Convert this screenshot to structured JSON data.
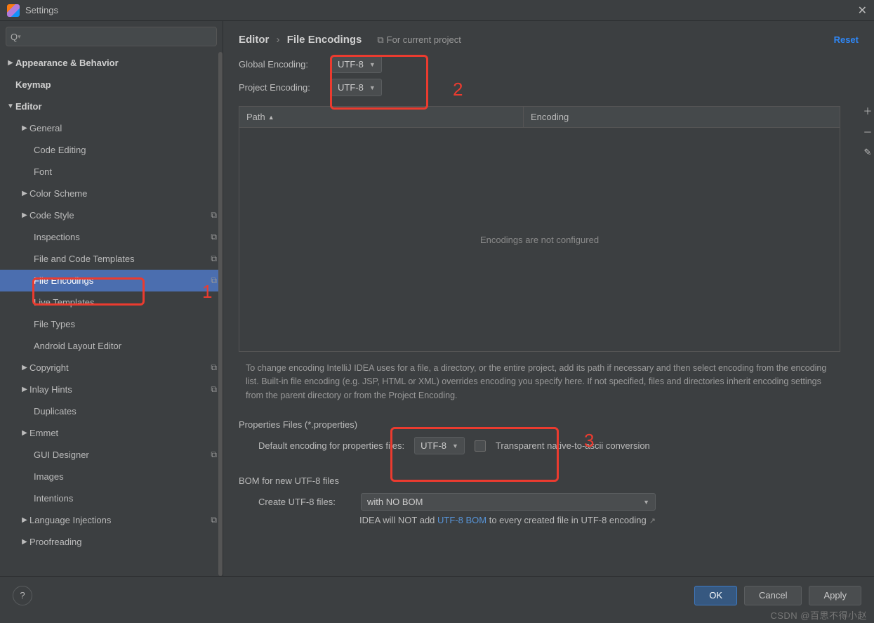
{
  "window": {
    "title": "Settings"
  },
  "search": {
    "placeholder": ""
  },
  "sidebar": {
    "items": [
      {
        "label": "Appearance & Behavior",
        "arrow": "▶",
        "bold": true,
        "indent": 0,
        "scheme": false
      },
      {
        "label": "Keymap",
        "arrow": "",
        "bold": true,
        "indent": 0,
        "scheme": false
      },
      {
        "label": "Editor",
        "arrow": "▼",
        "bold": true,
        "indent": 0,
        "scheme": false
      },
      {
        "label": "General",
        "arrow": "▶",
        "bold": false,
        "indent": 1,
        "scheme": false
      },
      {
        "label": "Code Editing",
        "arrow": "",
        "bold": false,
        "indent": 2,
        "scheme": false
      },
      {
        "label": "Font",
        "arrow": "",
        "bold": false,
        "indent": 2,
        "scheme": false
      },
      {
        "label": "Color Scheme",
        "arrow": "▶",
        "bold": false,
        "indent": 1,
        "scheme": false
      },
      {
        "label": "Code Style",
        "arrow": "▶",
        "bold": false,
        "indent": 1,
        "scheme": true
      },
      {
        "label": "Inspections",
        "arrow": "",
        "bold": false,
        "indent": 2,
        "scheme": true
      },
      {
        "label": "File and Code Templates",
        "arrow": "",
        "bold": false,
        "indent": 2,
        "scheme": true
      },
      {
        "label": "File Encodings",
        "arrow": "",
        "bold": false,
        "indent": 2,
        "scheme": true,
        "selected": true
      },
      {
        "label": "Live Templates",
        "arrow": "",
        "bold": false,
        "indent": 2,
        "scheme": false
      },
      {
        "label": "File Types",
        "arrow": "",
        "bold": false,
        "indent": 2,
        "scheme": false
      },
      {
        "label": "Android Layout Editor",
        "arrow": "",
        "bold": false,
        "indent": 2,
        "scheme": false
      },
      {
        "label": "Copyright",
        "arrow": "▶",
        "bold": false,
        "indent": 1,
        "scheme": true
      },
      {
        "label": "Inlay Hints",
        "arrow": "▶",
        "bold": false,
        "indent": 1,
        "scheme": true
      },
      {
        "label": "Duplicates",
        "arrow": "",
        "bold": false,
        "indent": 2,
        "scheme": false
      },
      {
        "label": "Emmet",
        "arrow": "▶",
        "bold": false,
        "indent": 1,
        "scheme": false
      },
      {
        "label": "GUI Designer",
        "arrow": "",
        "bold": false,
        "indent": 2,
        "scheme": true
      },
      {
        "label": "Images",
        "arrow": "",
        "bold": false,
        "indent": 2,
        "scheme": false
      },
      {
        "label": "Intentions",
        "arrow": "",
        "bold": false,
        "indent": 2,
        "scheme": false
      },
      {
        "label": "Language Injections",
        "arrow": "▶",
        "bold": false,
        "indent": 1,
        "scheme": true
      },
      {
        "label": "Proofreading",
        "arrow": "▶",
        "bold": false,
        "indent": 1,
        "scheme": false
      }
    ]
  },
  "breadcrumb": {
    "root": "Editor",
    "leaf": "File Encodings"
  },
  "for_project": "For current project",
  "reset": "Reset",
  "encodings": {
    "global_label": "Global Encoding:",
    "global_value": "UTF-8",
    "project_label": "Project Encoding:",
    "project_value": "UTF-8"
  },
  "table": {
    "path_header": "Path",
    "encoding_header": "Encoding",
    "empty_text": "Encodings are not configured"
  },
  "help_text": "To change encoding IntelliJ IDEA uses for a file, a directory, or the entire project, add its path if necessary and then select encoding from the encoding list. Built-in file encoding (e.g. JSP, HTML or XML) overrides encoding you specify here. If not specified, files and directories inherit encoding settings from the parent directory or from the Project Encoding.",
  "properties": {
    "section": "Properties Files (*.properties)",
    "default_label": "Default encoding for properties files:",
    "default_value": "UTF-8",
    "checkbox_label": "Transparent native-to-ascii conversion"
  },
  "bom": {
    "section": "BOM for new UTF-8 files",
    "create_label": "Create UTF-8 files:",
    "create_value": "with NO BOM",
    "note_prefix": "IDEA will NOT add ",
    "note_link": "UTF-8 BOM",
    "note_suffix": " to every created file in UTF-8 encoding"
  },
  "footer": {
    "ok": "OK",
    "cancel": "Cancel",
    "apply": "Apply"
  },
  "annotations": {
    "a1": "1",
    "a2": "2",
    "a3": "3"
  },
  "watermark": "CSDN @百思不得小赵"
}
